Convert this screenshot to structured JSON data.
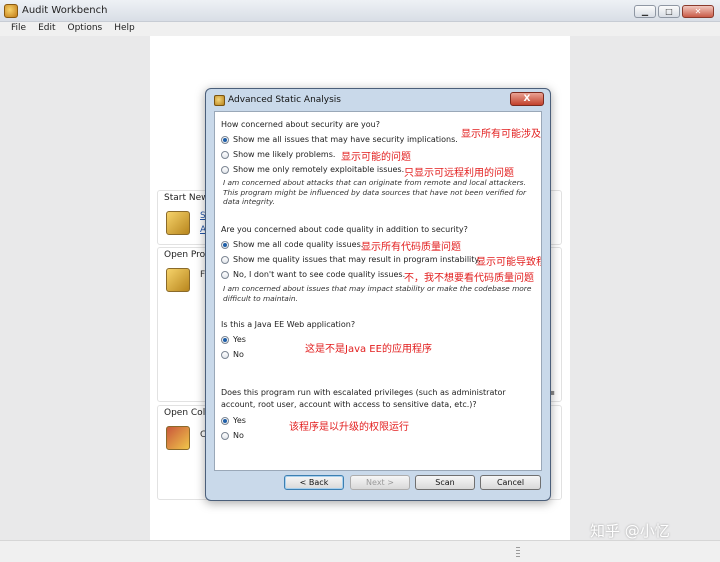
{
  "window": {
    "title": "Audit Workbench",
    "controls": {
      "minimize": "▁",
      "maximize": "□",
      "close": "✕"
    }
  },
  "menu": [
    "File",
    "Edit",
    "Options",
    "Help"
  ],
  "panels": {
    "start_new": {
      "title": "Start New",
      "link1": "S",
      "link2": "A"
    },
    "open_project": {
      "title": "Open Proj",
      "text": "F"
    },
    "open_collab": {
      "title": "Open Colla",
      "text": "C"
    }
  },
  "dialog": {
    "title": "Advanced Static Analysis",
    "close_label": "X",
    "security": {
      "question": "How concerned about security are you?",
      "options": [
        {
          "label": "Show me all issues that may have security implications.",
          "selected": true,
          "annotation": "显示所有可能涉及安全的问题"
        },
        {
          "label": "Show me likely problems.",
          "selected": false,
          "annotation": "显示可能的问题"
        },
        {
          "label": "Show me only remotely exploitable issues.",
          "selected": false,
          "annotation": "只显示可远程利用的问题"
        }
      ],
      "note": "I am concerned about attacks that can originate from remote and local attackers. This program might be influenced by data sources that have not been verified for data integrity."
    },
    "quality": {
      "question": "Are you concerned about code quality in addition to security?",
      "options": [
        {
          "label": "Show me all code quality issues.",
          "selected": true,
          "annotation": "显示所有代码质量问题"
        },
        {
          "label": "Show me quality issues that may result in program instability.",
          "selected": false,
          "annotation": "显示可能导致程序不稳定的质量问题"
        },
        {
          "label": "No, I don't want to see code quality issues.",
          "selected": false,
          "annotation": "不，我不想要看代码质量问题"
        }
      ],
      "note": "I am concerned about issues that may impact stability or make the codebase more difficult to maintain."
    },
    "javaee": {
      "question": "Is this a Java EE Web application?",
      "options": [
        {
          "label": "Yes",
          "selected": true
        },
        {
          "label": "No",
          "selected": false
        }
      ],
      "annotation": "这是不是Java EE的应用程序"
    },
    "privileges": {
      "question_line1": "Does this program run with escalated privileges (such as administrator",
      "question_line2": "account, root user, account with access to sensitive data, etc.)?",
      "options": [
        {
          "label": "Yes",
          "selected": true
        },
        {
          "label": "No",
          "selected": false
        }
      ],
      "annotation": "该程序是以升级的权限运行"
    },
    "buttons": {
      "back": "< Back",
      "next": "Next >",
      "scan": "Scan",
      "cancel": "Cancel"
    }
  },
  "watermark": "知乎 @小忆"
}
